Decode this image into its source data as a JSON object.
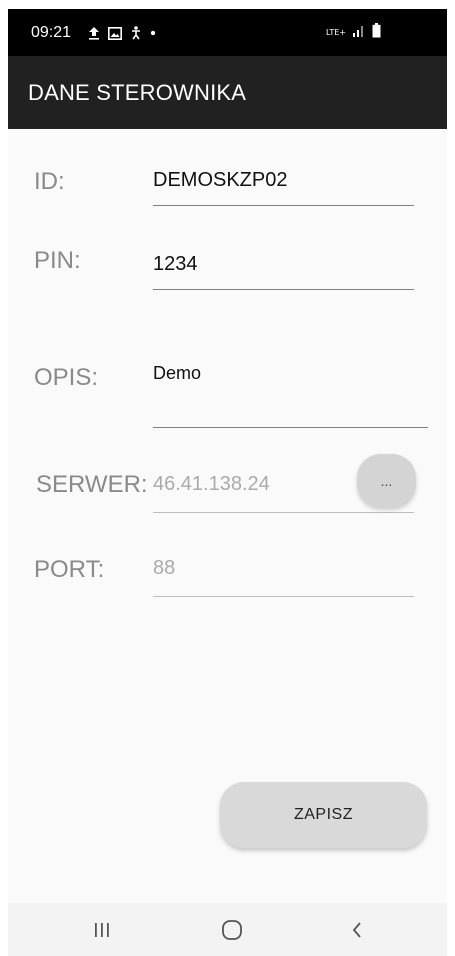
{
  "status_bar": {
    "time": "09:21",
    "network": "LTE+",
    "icons": [
      "upload-icon",
      "image-icon",
      "accessibility-icon",
      "dot-icon",
      "lte-icon",
      "signal-icon",
      "battery-icon"
    ]
  },
  "app_bar": {
    "title": "DANE STEROWNIKA"
  },
  "form": {
    "id": {
      "label": "ID:",
      "value": "DEMOSKZP02"
    },
    "pin": {
      "label": "PIN:",
      "value": "1234"
    },
    "opis": {
      "label": "OPIS:",
      "value": "Demo"
    },
    "serwer": {
      "label": "SERWER:",
      "value": "46.41.138.24",
      "more_label": "..."
    },
    "port": {
      "label": "PORT:",
      "value": "88"
    }
  },
  "save_button": {
    "label": "ZAPISZ"
  },
  "nav_bar": {
    "icons": [
      "recent-apps-icon",
      "home-icon",
      "back-icon"
    ]
  },
  "colors": {
    "app_bar": "#212121",
    "status_bar": "#000000",
    "background": "#fafafa",
    "button": "#d9d9d9"
  }
}
